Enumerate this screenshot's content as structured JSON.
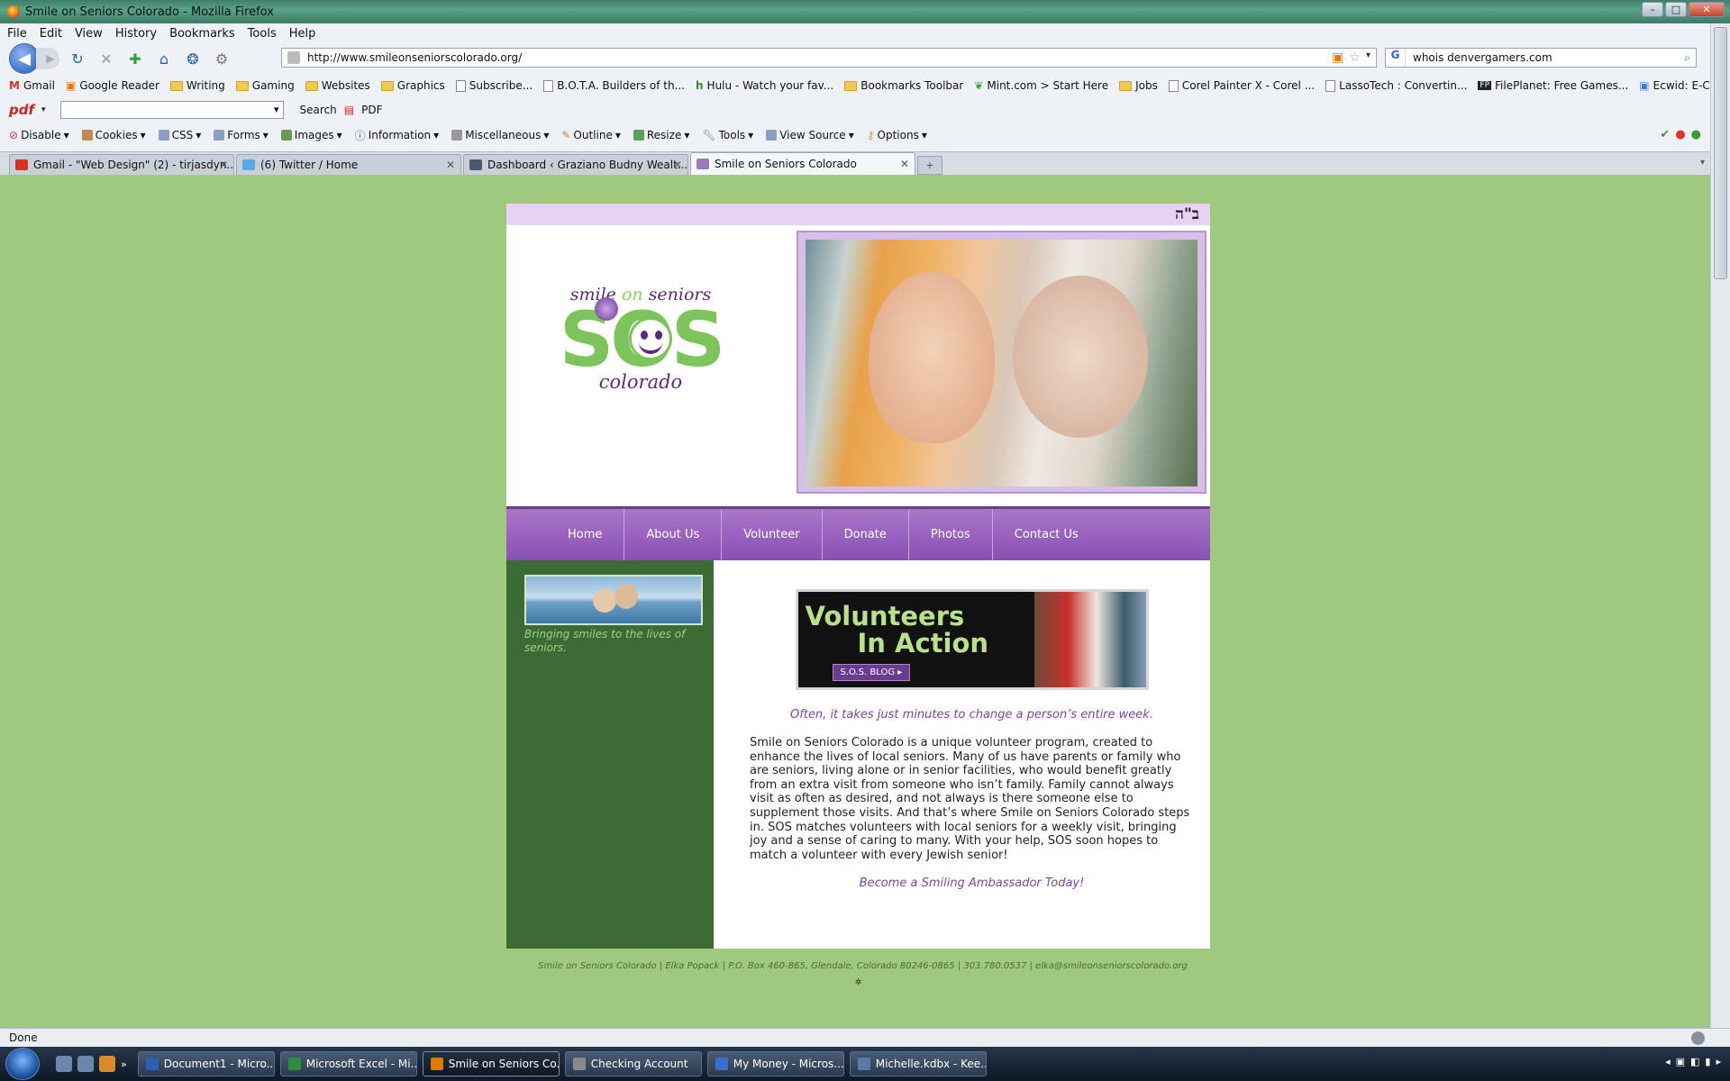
{
  "window": {
    "title": "Smile on Seniors Colorado - Mozilla Firefox"
  },
  "menu": [
    "File",
    "Edit",
    "View",
    "History",
    "Bookmarks",
    "Tools",
    "Help"
  ],
  "url": "http://www.smileonseniorscolorado.org/",
  "search_value": "whois denvergamers.com",
  "bookmarks": [
    "Gmail",
    "Google Reader",
    "Writing",
    "Gaming",
    "Websites",
    "Graphics",
    "Subscribe...",
    "B.O.T.A. Builders of th...",
    "Hulu - Watch your fav...",
    "Bookmarks Toolbar",
    "Mint.com > Start Here",
    "Jobs",
    "Corel Painter X - Corel ...",
    "LassoTech : Convertin...",
    "FilePlanet: Free Games...",
    "Ecwid: E-Commerce ..."
  ],
  "pdfbar": {
    "search_label": "Search",
    "pdf_label": "PDF"
  },
  "webdev": [
    "Disable",
    "Cookies",
    "CSS",
    "Forms",
    "Images",
    "Information",
    "Miscellaneous",
    "Outline",
    "Resize",
    "Tools",
    "View Source",
    "Options"
  ],
  "tabs": [
    {
      "label": "Gmail - \"Web Design\" (2) - tirjasdyn...",
      "color": "#d93025"
    },
    {
      "label": "(6) Twitter / Home",
      "color": "#5aa9e6"
    },
    {
      "label": "Dashboard ‹ Graziano Budny Wealt...",
      "color": "#4a5a6a"
    },
    {
      "label": "Smile on Seniors Colorado",
      "color": "#9a7ab8"
    }
  ],
  "site": {
    "hebrew": "ב\"ה",
    "logo_top": "smile on seniors",
    "logo_top_a": "smile ",
    "logo_top_b": "on",
    "logo_top_c": " seniors",
    "logo_sos": "SOS",
    "logo_bottom": "colorado",
    "nav": [
      "Home",
      "About Us",
      "Volunteer",
      "Donate",
      "Photos",
      "Contact Us"
    ],
    "sidebar_caption": "Bringing smiles to the lives of seniors.",
    "banner_line1": "Volunteers",
    "banner_line2": "In Action",
    "banner_button": "S.O.S. BLOG ▸",
    "quote": "Often, it takes just minutes to change a person’s entire week.",
    "paragraph": "Smile on Seniors Colorado is a unique volunteer program, created to enhance the lives of local seniors. Many of us have parents or family who are seniors, living alone or in senior facilities, who would benefit greatly from an extra visit from someone who isn’t family. Family cannot always visit as often as desired, and not always is there someone else to supplement those visits. And that’s where Smile on Seniors Colorado steps in. SOS matches volunteers with local seniors for a weekly visit, bringing joy and a sense of caring to many. With your help, SOS soon hopes to match a volunteer with every Jewish senior!",
    "cta": "Become a Smiling Ambassador Today!",
    "footer": "Smile on Seniors Colorado | Elka Popack | P.O. Box 460-865, Glendale, Colorado 80246-0865 | 303.780.0537 | elka@smileonseniorscolorado.org"
  },
  "status": "Done",
  "taskbar": [
    {
      "label": "Document1 - Micro...",
      "color": "#2b5fb5"
    },
    {
      "label": "Microsoft Excel - Mi...",
      "color": "#2e8b3c"
    },
    {
      "label": "Smile on Seniors Co...",
      "color": "#e07a00"
    },
    {
      "label": "Checking Account",
      "color": "#8a8a8a"
    },
    {
      "label": "My Money - Micros...",
      "color": "#3a6fcf"
    },
    {
      "label": "Michelle.kdbx - Kee...",
      "color": "#5a7aa8"
    }
  ]
}
